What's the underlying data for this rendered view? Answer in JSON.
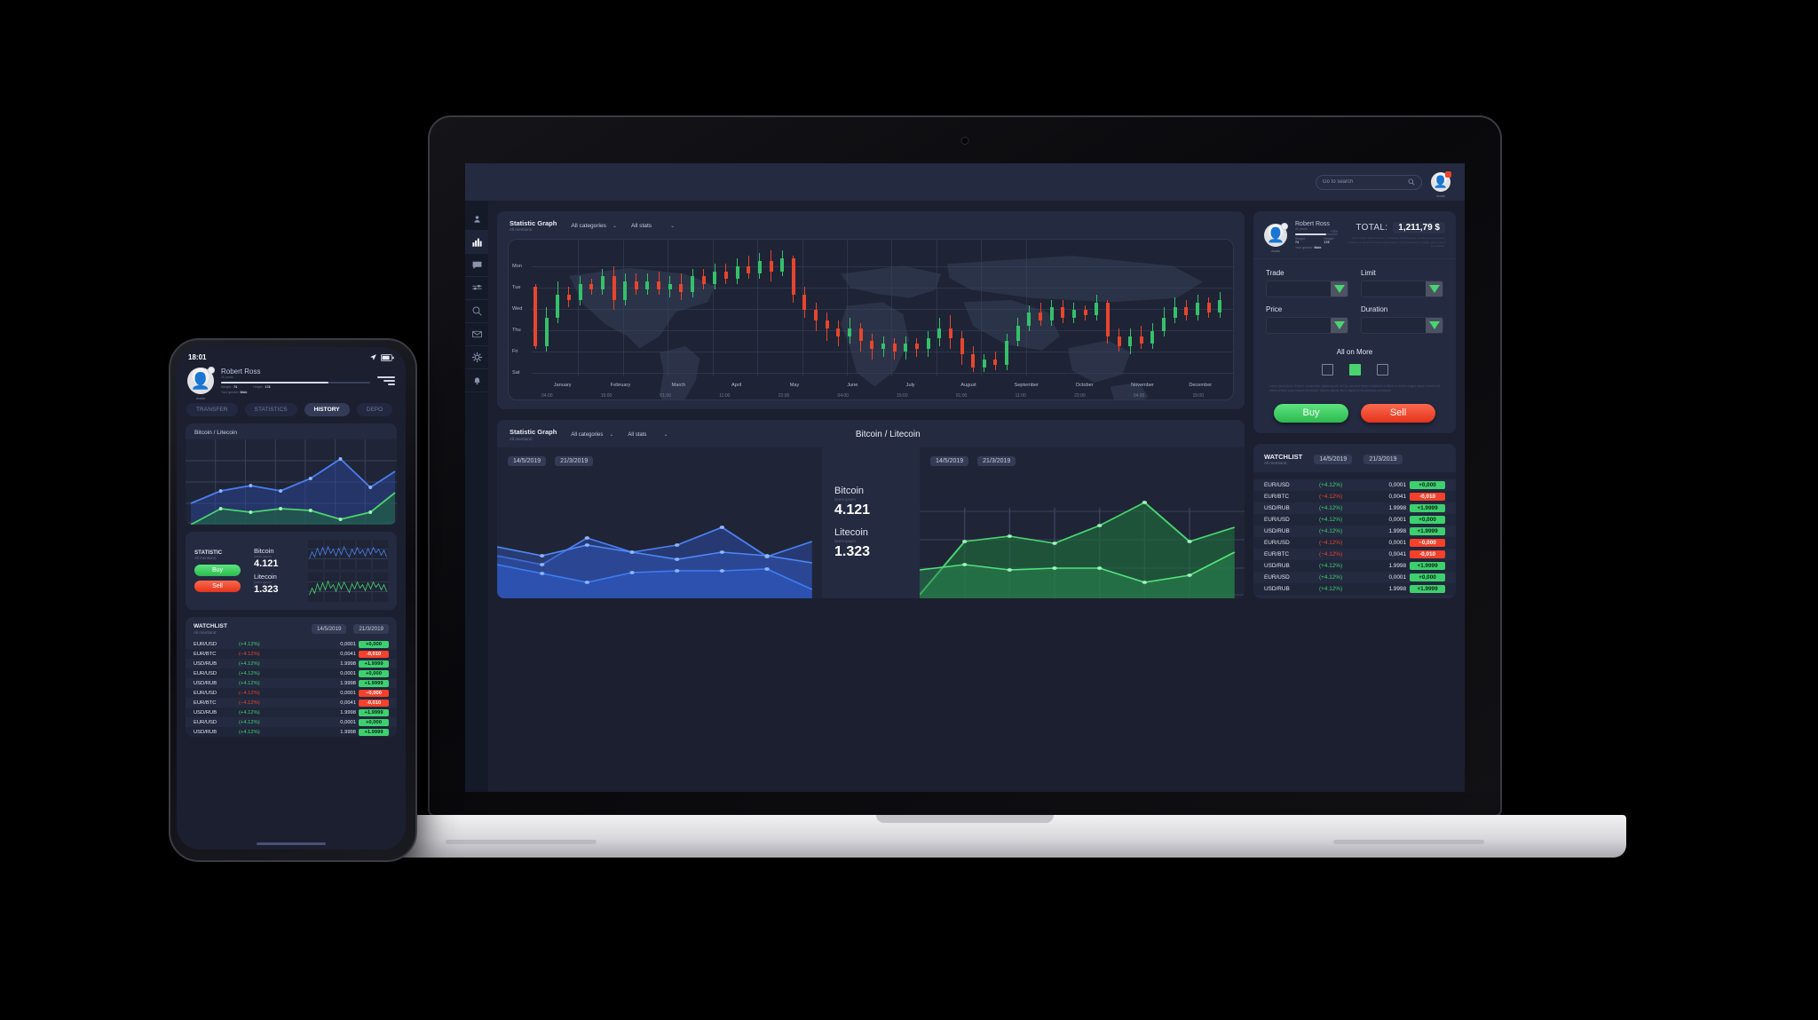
{
  "topbar": {
    "search_placeholder": "Go to search",
    "search_value": "",
    "search_icon": "search-icon",
    "avatar_caption": "Avatar"
  },
  "sidebar": {
    "items": [
      {
        "icon": "user-icon",
        "active": false
      },
      {
        "icon": "bar-chart-icon",
        "active": true
      },
      {
        "icon": "chat-bubble-icon",
        "active": false
      },
      {
        "icon": "sliders-icon",
        "active": false
      },
      {
        "icon": "search-icon",
        "active": false
      },
      {
        "icon": "mail-icon",
        "active": false
      },
      {
        "icon": "gear-icon",
        "active": false
      },
      {
        "icon": "bell-icon",
        "active": false
      }
    ]
  },
  "candle_card": {
    "title": "Statistic Graph",
    "subtitle": "All mentions:",
    "filter_categories": "All categories",
    "filter_stats": "All stats",
    "chevron": "⌄"
  },
  "trade": {
    "profile": {
      "name": "Robert Ross",
      "years": "30 years",
      "progress_label": "+78%",
      "weight_label": "Weight :",
      "weight_value": "74",
      "height_label": "Height :",
      "height_value": "178",
      "gender_label": "Your gender:",
      "gender_value": "Male",
      "avatar_caption": "Avatar"
    },
    "total_label": "TOTAL:",
    "total_value": "1,211,79 $",
    "total_note": "Lorem ipsum dolor sit amet, consectetur adipiscing elit, sed do eiusmod tempor incididunt ut labore et dolore magna aliqua. Ut enim ad minim veniam, quis nostrud exercitation.",
    "fields": [
      {
        "label": "Trade",
        "value": ""
      },
      {
        "label": "Limit",
        "value": ""
      },
      {
        "label": "Price",
        "value": ""
      },
      {
        "label": "Duration",
        "value": ""
      }
    ],
    "all_on_more": "All on More",
    "checkboxes": [
      false,
      true,
      false
    ],
    "lorem": "Lorem ipsum dolor sit amet, consectetur adipiscing elit, sed do eiusmod tempor incididunt ut labore et dolore magna aliqua. Ut enim ad minim veniam, quis nostrud exercitation ullamco laboris nisi ut aliquip ex ea commodo consequat.",
    "buy_label": "Buy",
    "sell_label": "Sell",
    "buy_color": "#2cb94f",
    "sell_color": "#e5331c"
  },
  "watchlist": {
    "title": "WATCHLIST",
    "subtitle": "All mentions:",
    "date_from": "14/5/2019",
    "date_to": "21/3/2019",
    "rows": [
      {
        "pair": "EUR/USD",
        "pct": "(+4.12%)",
        "num": "0,0001",
        "tag": "+0,000",
        "dir": "up"
      },
      {
        "pair": "EUR/BTC",
        "pct": "(−4.12%)",
        "num": "0,0041",
        "tag": "-0,010",
        "dir": "dn"
      },
      {
        "pair": "USD/RUB",
        "pct": "(+4.12%)",
        "num": "1.9998",
        "tag": "+1.9999",
        "dir": "up"
      },
      {
        "pair": "EUR/USD",
        "pct": "(+4.12%)",
        "num": "0,0001",
        "tag": "+0,000",
        "dir": "up"
      },
      {
        "pair": "USD/RUB",
        "pct": "(+4.12%)",
        "num": "1.9998",
        "tag": "+1.9999",
        "dir": "up"
      },
      {
        "pair": "EUR/USD",
        "pct": "(−4.12%)",
        "num": "0,0001",
        "tag": "−0,000",
        "dir": "dn"
      },
      {
        "pair": "EUR/BTC",
        "pct": "(−4.12%)",
        "num": "0,0041",
        "tag": "-0,010",
        "dir": "dn"
      },
      {
        "pair": "USD/RUB",
        "pct": "(+4.12%)",
        "num": "1.9998",
        "tag": "+1.9999",
        "dir": "up"
      },
      {
        "pair": "EUR/USD",
        "pct": "(+4.12%)",
        "num": "0,0001",
        "tag": "+0,000",
        "dir": "up"
      },
      {
        "pair": "USD/RUB",
        "pct": "(+4.12%)",
        "num": "1.9998",
        "tag": "+1.9999",
        "dir": "up"
      }
    ]
  },
  "dual_card": {
    "title": "Statistic Graph",
    "subtitle": "All mentions:",
    "filter_categories": "All categories",
    "filter_stats": "All stats",
    "heading": "Bitcoin / Litecoin",
    "date_from": "14/5/2019",
    "date_to": "21/3/2019",
    "bitcoin_name": "Bitcoin",
    "bitcoin_sub": "lorem ipsum",
    "bitcoin_value": "4.121",
    "litecoin_name": "Litecoin",
    "litecoin_sub": "lorem ipsum",
    "litecoin_value": "1.323"
  },
  "phone": {
    "time": "18:01",
    "profile_name": "Robert Ross",
    "profile_years": "30 years",
    "weight_label": "Weight :",
    "weight_value": "74",
    "height_label": "Height :",
    "height_value": "178",
    "gender_label": "Your gender:",
    "gender_value": "Male",
    "avatar_caption": "Avatar",
    "tabs": [
      {
        "label": "TRANSFER",
        "active": false
      },
      {
        "label": "STATISTICS",
        "active": false
      },
      {
        "label": "HISTORY",
        "active": true
      },
      {
        "label": "DEPO",
        "active": false
      }
    ],
    "chart_title": "Bitcoin / Litecoin",
    "statistic_title": "STATISTIC",
    "statistic_sub": "All mentions:",
    "buy_label": "Buy",
    "sell_label": "Sell",
    "bitcoin_name": "Bitcoin",
    "bitcoin_sub": "lorem ipsum",
    "bitcoin_value": "4.121",
    "litecoin_name": "Litecoin",
    "litecoin_sub": "lorem ipsum",
    "litecoin_value": "1.323",
    "watchlist_title": "WATCHLIST",
    "watchlist_sub": "All mentions:",
    "date_from": "14/5/2019",
    "date_to": "21/3/2019"
  },
  "chart_data": [
    {
      "type": "candlestick",
      "title": "Statistic Graph",
      "xlabel": "",
      "ylabel": "",
      "grid": true,
      "ytick_labels": [
        "Mon",
        "Tue",
        "Wed",
        "Thu",
        "Fri",
        "Sat"
      ],
      "xtick_labels": [
        "January",
        "February",
        "March",
        "April",
        "May",
        "June",
        "July",
        "August",
        "September",
        "October",
        "November",
        "December"
      ],
      "xtick_times": [
        "04:00",
        "15:00",
        "01:00",
        "11:00",
        "22:00",
        "04:00",
        "15:00",
        "01:00",
        "11:00",
        "22:00",
        "04:00",
        "15:00"
      ],
      "up_color": "#35c06a",
      "down_color": "#e8452c",
      "candles": [
        {
          "o": 68,
          "c": 22,
          "h": 70,
          "l": 20,
          "dir": "dn"
        },
        {
          "o": 22,
          "c": 44,
          "h": 52,
          "l": 18,
          "dir": "up"
        },
        {
          "o": 44,
          "c": 62,
          "h": 72,
          "l": 40,
          "dir": "up"
        },
        {
          "o": 62,
          "c": 58,
          "h": 68,
          "l": 52,
          "dir": "dn"
        },
        {
          "o": 58,
          "c": 70,
          "h": 76,
          "l": 54,
          "dir": "up"
        },
        {
          "o": 70,
          "c": 66,
          "h": 74,
          "l": 62,
          "dir": "dn"
        },
        {
          "o": 66,
          "c": 76,
          "h": 82,
          "l": 62,
          "dir": "up"
        },
        {
          "o": 76,
          "c": 58,
          "h": 84,
          "l": 50,
          "dir": "dn"
        },
        {
          "o": 58,
          "c": 72,
          "h": 78,
          "l": 54,
          "dir": "up"
        },
        {
          "o": 72,
          "c": 66,
          "h": 78,
          "l": 62,
          "dir": "dn"
        },
        {
          "o": 66,
          "c": 72,
          "h": 78,
          "l": 62,
          "dir": "up"
        },
        {
          "o": 72,
          "c": 66,
          "h": 80,
          "l": 62,
          "dir": "dn"
        },
        {
          "o": 66,
          "c": 70,
          "h": 76,
          "l": 60,
          "dir": "up"
        },
        {
          "o": 70,
          "c": 64,
          "h": 78,
          "l": 58,
          "dir": "dn"
        },
        {
          "o": 64,
          "c": 76,
          "h": 82,
          "l": 60,
          "dir": "up"
        },
        {
          "o": 76,
          "c": 70,
          "h": 82,
          "l": 66,
          "dir": "dn"
        },
        {
          "o": 70,
          "c": 80,
          "h": 86,
          "l": 66,
          "dir": "up"
        },
        {
          "o": 80,
          "c": 74,
          "h": 86,
          "l": 70,
          "dir": "dn"
        },
        {
          "o": 74,
          "c": 84,
          "h": 90,
          "l": 70,
          "dir": "up"
        },
        {
          "o": 84,
          "c": 78,
          "h": 92,
          "l": 74,
          "dir": "dn"
        },
        {
          "o": 78,
          "c": 88,
          "h": 94,
          "l": 74,
          "dir": "up"
        },
        {
          "o": 88,
          "c": 80,
          "h": 96,
          "l": 72,
          "dir": "dn"
        },
        {
          "o": 80,
          "c": 90,
          "h": 96,
          "l": 76,
          "dir": "up"
        },
        {
          "o": 90,
          "c": 62,
          "h": 92,
          "l": 56,
          "dir": "dn"
        },
        {
          "o": 62,
          "c": 50,
          "h": 68,
          "l": 44,
          "dir": "dn"
        },
        {
          "o": 50,
          "c": 42,
          "h": 56,
          "l": 34,
          "dir": "dn"
        },
        {
          "o": 42,
          "c": 36,
          "h": 48,
          "l": 26,
          "dir": "dn"
        },
        {
          "o": 36,
          "c": 30,
          "h": 42,
          "l": 22,
          "dir": "dn"
        },
        {
          "o": 30,
          "c": 36,
          "h": 44,
          "l": 24,
          "dir": "up"
        },
        {
          "o": 36,
          "c": 26,
          "h": 40,
          "l": 18,
          "dir": "dn"
        },
        {
          "o": 26,
          "c": 20,
          "h": 32,
          "l": 12,
          "dir": "dn"
        },
        {
          "o": 20,
          "c": 24,
          "h": 30,
          "l": 14,
          "dir": "up"
        },
        {
          "o": 24,
          "c": 18,
          "h": 28,
          "l": 12,
          "dir": "dn"
        },
        {
          "o": 18,
          "c": 24,
          "h": 30,
          "l": 12,
          "dir": "up"
        },
        {
          "o": 24,
          "c": 20,
          "h": 28,
          "l": 14,
          "dir": "dn"
        },
        {
          "o": 20,
          "c": 28,
          "h": 34,
          "l": 14,
          "dir": "up"
        },
        {
          "o": 28,
          "c": 36,
          "h": 44,
          "l": 22,
          "dir": "up"
        },
        {
          "o": 36,
          "c": 28,
          "h": 46,
          "l": 20,
          "dir": "dn"
        },
        {
          "o": 28,
          "c": 16,
          "h": 34,
          "l": 8,
          "dir": "dn"
        },
        {
          "o": 16,
          "c": 6,
          "h": 22,
          "l": 2,
          "dir": "dn"
        },
        {
          "o": 6,
          "c": 12,
          "h": 16,
          "l": 2,
          "dir": "up"
        },
        {
          "o": 12,
          "c": 8,
          "h": 18,
          "l": 4,
          "dir": "dn"
        },
        {
          "o": 8,
          "c": 26,
          "h": 32,
          "l": 4,
          "dir": "up"
        },
        {
          "o": 26,
          "c": 38,
          "h": 44,
          "l": 22,
          "dir": "up"
        },
        {
          "o": 38,
          "c": 48,
          "h": 54,
          "l": 34,
          "dir": "up"
        },
        {
          "o": 48,
          "c": 42,
          "h": 56,
          "l": 38,
          "dir": "dn"
        },
        {
          "o": 42,
          "c": 52,
          "h": 58,
          "l": 38,
          "dir": "up"
        },
        {
          "o": 52,
          "c": 44,
          "h": 58,
          "l": 40,
          "dir": "dn"
        },
        {
          "o": 44,
          "c": 50,
          "h": 56,
          "l": 40,
          "dir": "up"
        },
        {
          "o": 50,
          "c": 46,
          "h": 54,
          "l": 42,
          "dir": "dn"
        },
        {
          "o": 46,
          "c": 56,
          "h": 62,
          "l": 42,
          "dir": "up"
        },
        {
          "o": 56,
          "c": 30,
          "h": 58,
          "l": 24,
          "dir": "dn"
        },
        {
          "o": 30,
          "c": 22,
          "h": 36,
          "l": 18,
          "dir": "dn"
        },
        {
          "o": 22,
          "c": 30,
          "h": 36,
          "l": 16,
          "dir": "up"
        },
        {
          "o": 30,
          "c": 24,
          "h": 38,
          "l": 20,
          "dir": "dn"
        },
        {
          "o": 24,
          "c": 34,
          "h": 40,
          "l": 20,
          "dir": "up"
        },
        {
          "o": 34,
          "c": 44,
          "h": 52,
          "l": 30,
          "dir": "up"
        },
        {
          "o": 44,
          "c": 52,
          "h": 60,
          "l": 40,
          "dir": "up"
        },
        {
          "o": 52,
          "c": 46,
          "h": 58,
          "l": 42,
          "dir": "dn"
        },
        {
          "o": 46,
          "c": 56,
          "h": 62,
          "l": 42,
          "dir": "up"
        },
        {
          "o": 56,
          "c": 48,
          "h": 60,
          "l": 44,
          "dir": "dn"
        },
        {
          "o": 48,
          "c": 58,
          "h": 64,
          "l": 44,
          "dir": "up"
        }
      ]
    },
    {
      "type": "area",
      "title": "Bitcoin",
      "color": "#3f6fe0",
      "grid": true,
      "series": [
        {
          "name": "bitcoin-upper",
          "values": [
            38,
            30,
            52,
            42,
            48,
            62,
            40,
            55
          ]
        },
        {
          "name": "bitcoin-mid",
          "values": [
            48,
            40,
            50,
            44,
            38,
            44,
            42,
            36
          ]
        },
        {
          "name": "bitcoin-lower",
          "values": [
            30,
            22,
            12,
            22,
            24,
            24,
            26,
            6
          ]
        }
      ]
    },
    {
      "type": "area",
      "title": "Litecoin",
      "color": "#3ec96b",
      "grid": true,
      "series": [
        {
          "name": "litecoin-upper",
          "values": [
            6,
            46,
            50,
            44,
            56,
            76,
            46,
            60
          ]
        },
        {
          "name": "litecoin-lower",
          "values": [
            22,
            26,
            22,
            24,
            24,
            12,
            20,
            42
          ]
        }
      ]
    }
  ]
}
